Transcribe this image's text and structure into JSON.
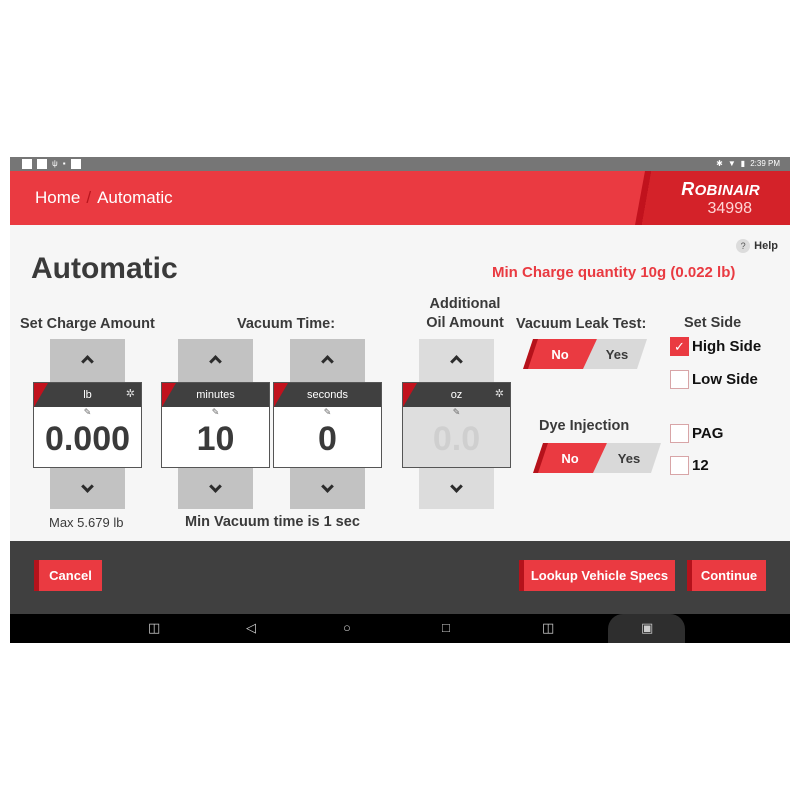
{
  "status_bar": {
    "left_icons": [
      "notification-icon",
      "notification-icon",
      "usb-icon",
      "image-icon",
      "notification-icon"
    ],
    "right_icons": [
      "bluetooth-icon",
      "wifi-icon",
      "battery-icon"
    ],
    "time": "2:39 PM"
  },
  "header": {
    "breadcrumb": [
      "Home",
      "Automatic"
    ],
    "separator": "/",
    "brand_first": "R",
    "brand_rest": "OBINAIR",
    "model": "34998",
    "accent_color": "#ea3a41"
  },
  "help": {
    "icon": "?",
    "label": "Help"
  },
  "page_title": "Automatic",
  "min_charge_text": "Min Charge quantity 10g (0.022 lb)",
  "charge": {
    "label": "Set Charge Amount",
    "unit": "lb",
    "value": "0.000",
    "note": "Max 5.679 lb"
  },
  "vacuum": {
    "label": "Vacuum Time:",
    "minutes_unit": "minutes",
    "minutes_value": "10",
    "seconds_unit": "seconds",
    "seconds_value": "0",
    "note": "Min Vacuum time is 1 sec"
  },
  "oil": {
    "label_line1": "Additional",
    "label_line2": "Oil Amount",
    "unit": "oz",
    "value": "0.0",
    "disabled": true
  },
  "vacuum_leak_test": {
    "label": "Vacuum Leak Test:",
    "no": "No",
    "yes": "Yes",
    "selected": "No"
  },
  "dye_injection": {
    "label": "Dye Injection",
    "no": "No",
    "yes": "Yes",
    "selected": "No"
  },
  "set_side": {
    "label": "Set Side",
    "options": [
      {
        "label": "High Side",
        "checked": true
      },
      {
        "label": "Low Side",
        "checked": false
      }
    ]
  },
  "oil_type": {
    "options": [
      {
        "label": "PAG",
        "checked": false
      },
      {
        "label": "12",
        "checked": false
      }
    ]
  },
  "footer": {
    "cancel": "Cancel",
    "lookup": "Lookup Vehicle Specs",
    "continue": "Continue"
  },
  "icons": {
    "check": "✓",
    "gear": "✲",
    "pencil": "✎"
  }
}
